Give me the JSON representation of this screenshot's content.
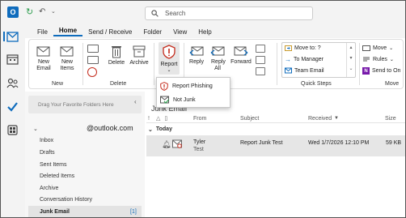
{
  "titlebar": {
    "search_placeholder": "Search"
  },
  "menu": {
    "file": "File",
    "home": "Home",
    "send_receive": "Send / Receive",
    "folder": "Folder",
    "view": "View",
    "help": "Help"
  },
  "ribbon": {
    "new_email": "New Email",
    "new_items": "New Items",
    "new_group": "New",
    "delete": "Delete",
    "archive": "Archive",
    "delete_group": "Delete",
    "report": "Report",
    "reply": "Reply",
    "reply_all": "Reply All",
    "forward": "Forward",
    "move_to": "Move to: ?",
    "to_manager": "To Manager",
    "team_email": "Team Email",
    "quick_steps": "Quick Steps",
    "move": "Move",
    "rules": "Rules",
    "send_to_onenote": "Send to On",
    "move_group": "Move"
  },
  "report_menu": {
    "report_phishing": "Report Phishing",
    "not_junk": "Not Junk"
  },
  "folders": {
    "favorites_hint": "Drag Your Favorite Folders Here",
    "account": "@outlook.com",
    "items": [
      "Inbox",
      "Drafts",
      "Sent Items",
      "Deleted Items",
      "Archive",
      "Conversation History",
      "Junk Email"
    ],
    "junk_count": "[1]"
  },
  "list": {
    "folder_title": "Junk Email",
    "columns": {
      "from": "From",
      "subject": "Subject",
      "received": "Received",
      "size": "Size"
    },
    "group": "Today",
    "message": {
      "from": "Tyler",
      "from_sub": "Test",
      "subject": "Report Junk Test",
      "received": "Wed 1/7/2026 12:10 PM",
      "size": "59 KB"
    }
  },
  "colors": {
    "accent": "#0f6cbd",
    "report_red": "#c42b1c",
    "selected_row": "#e6e6e6"
  }
}
